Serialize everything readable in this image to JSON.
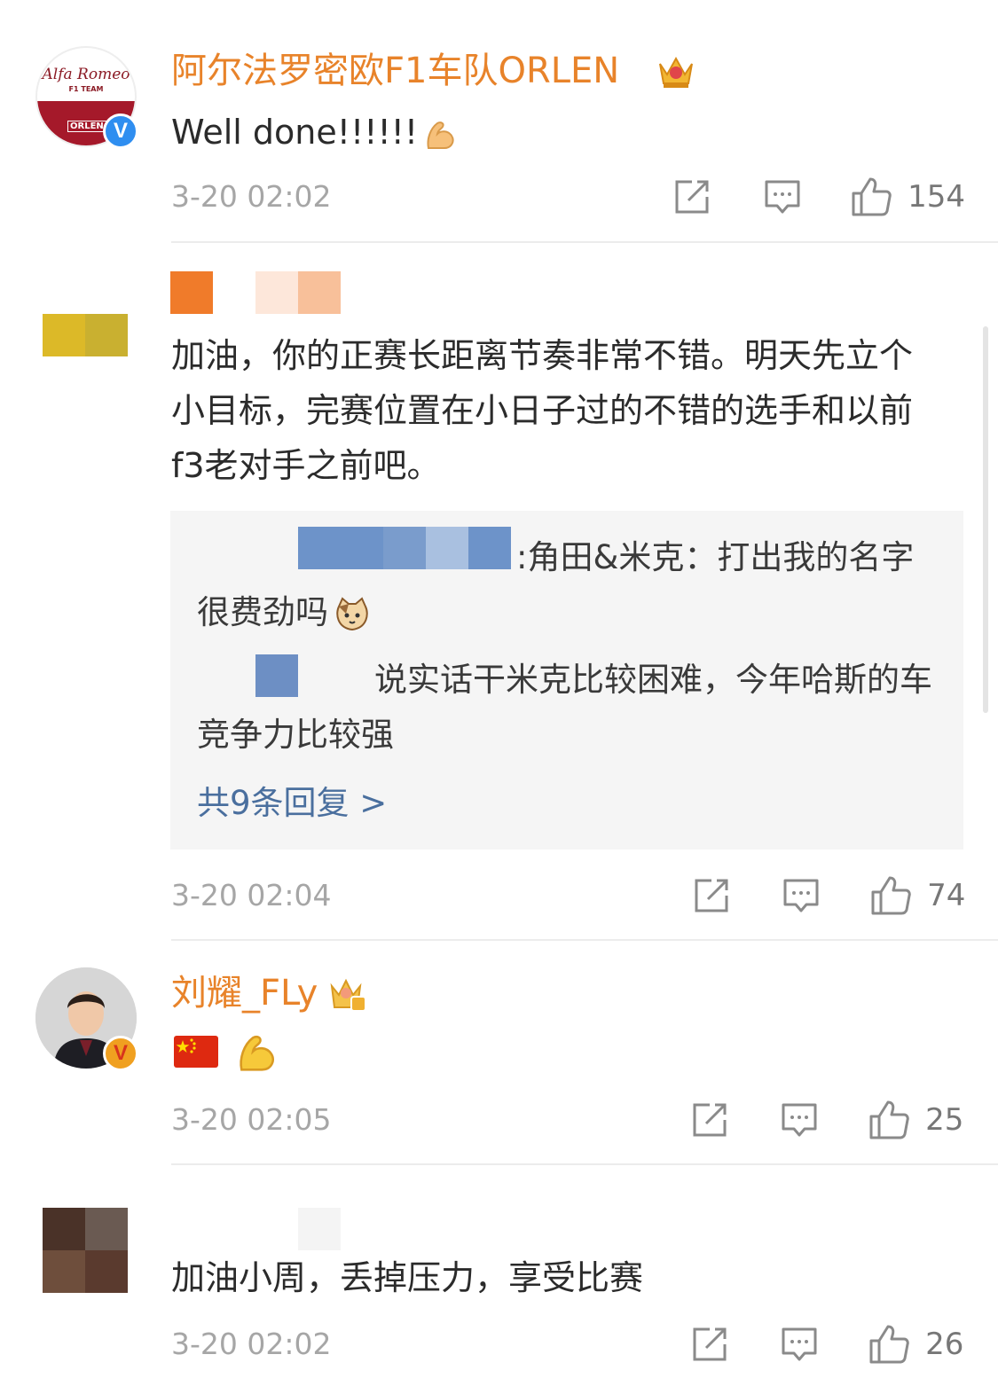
{
  "comments": [
    {
      "user": "阿尔法罗密欧F1车队ORLEN",
      "text": "Well done!!!!!!",
      "time": "3-20 02:02",
      "likes": "154",
      "avatar_logo": "Alfa Romeo",
      "avatar_sub": "F1 TEAM",
      "avatar_sponsor": "ORLEN",
      "verified_color": "#2f8ef0"
    },
    {
      "text": "加油，你的正赛长距离节奏非常不错。明天先立个小目标，完赛位置在小日子过的不错的选手和以前f3老对手之前吧。",
      "time": "3-20 02:04",
      "likes": "74",
      "replies": [
        {
          "text": ":角田&米克：打出我的名字很费劲吗"
        },
        {
          "text": "说实话干米克比较困难，今年哈斯的车竞争力比较强"
        }
      ],
      "more_replies": "共9条回复 >"
    },
    {
      "user": "刘耀_FLy",
      "time": "3-20 02:05",
      "likes": "25",
      "verified_color": "#f0a020"
    },
    {
      "text": "加油小周，丢掉压力，享受比赛",
      "time": "3-20 02:02",
      "likes": "26"
    }
  ],
  "icons": {
    "repost": "repost-icon",
    "comment": "comment-icon",
    "like": "like-icon"
  },
  "colors": {
    "username": "#e8832a",
    "link": "#4a6f9e",
    "reply_bg": "#f5f5f5"
  }
}
